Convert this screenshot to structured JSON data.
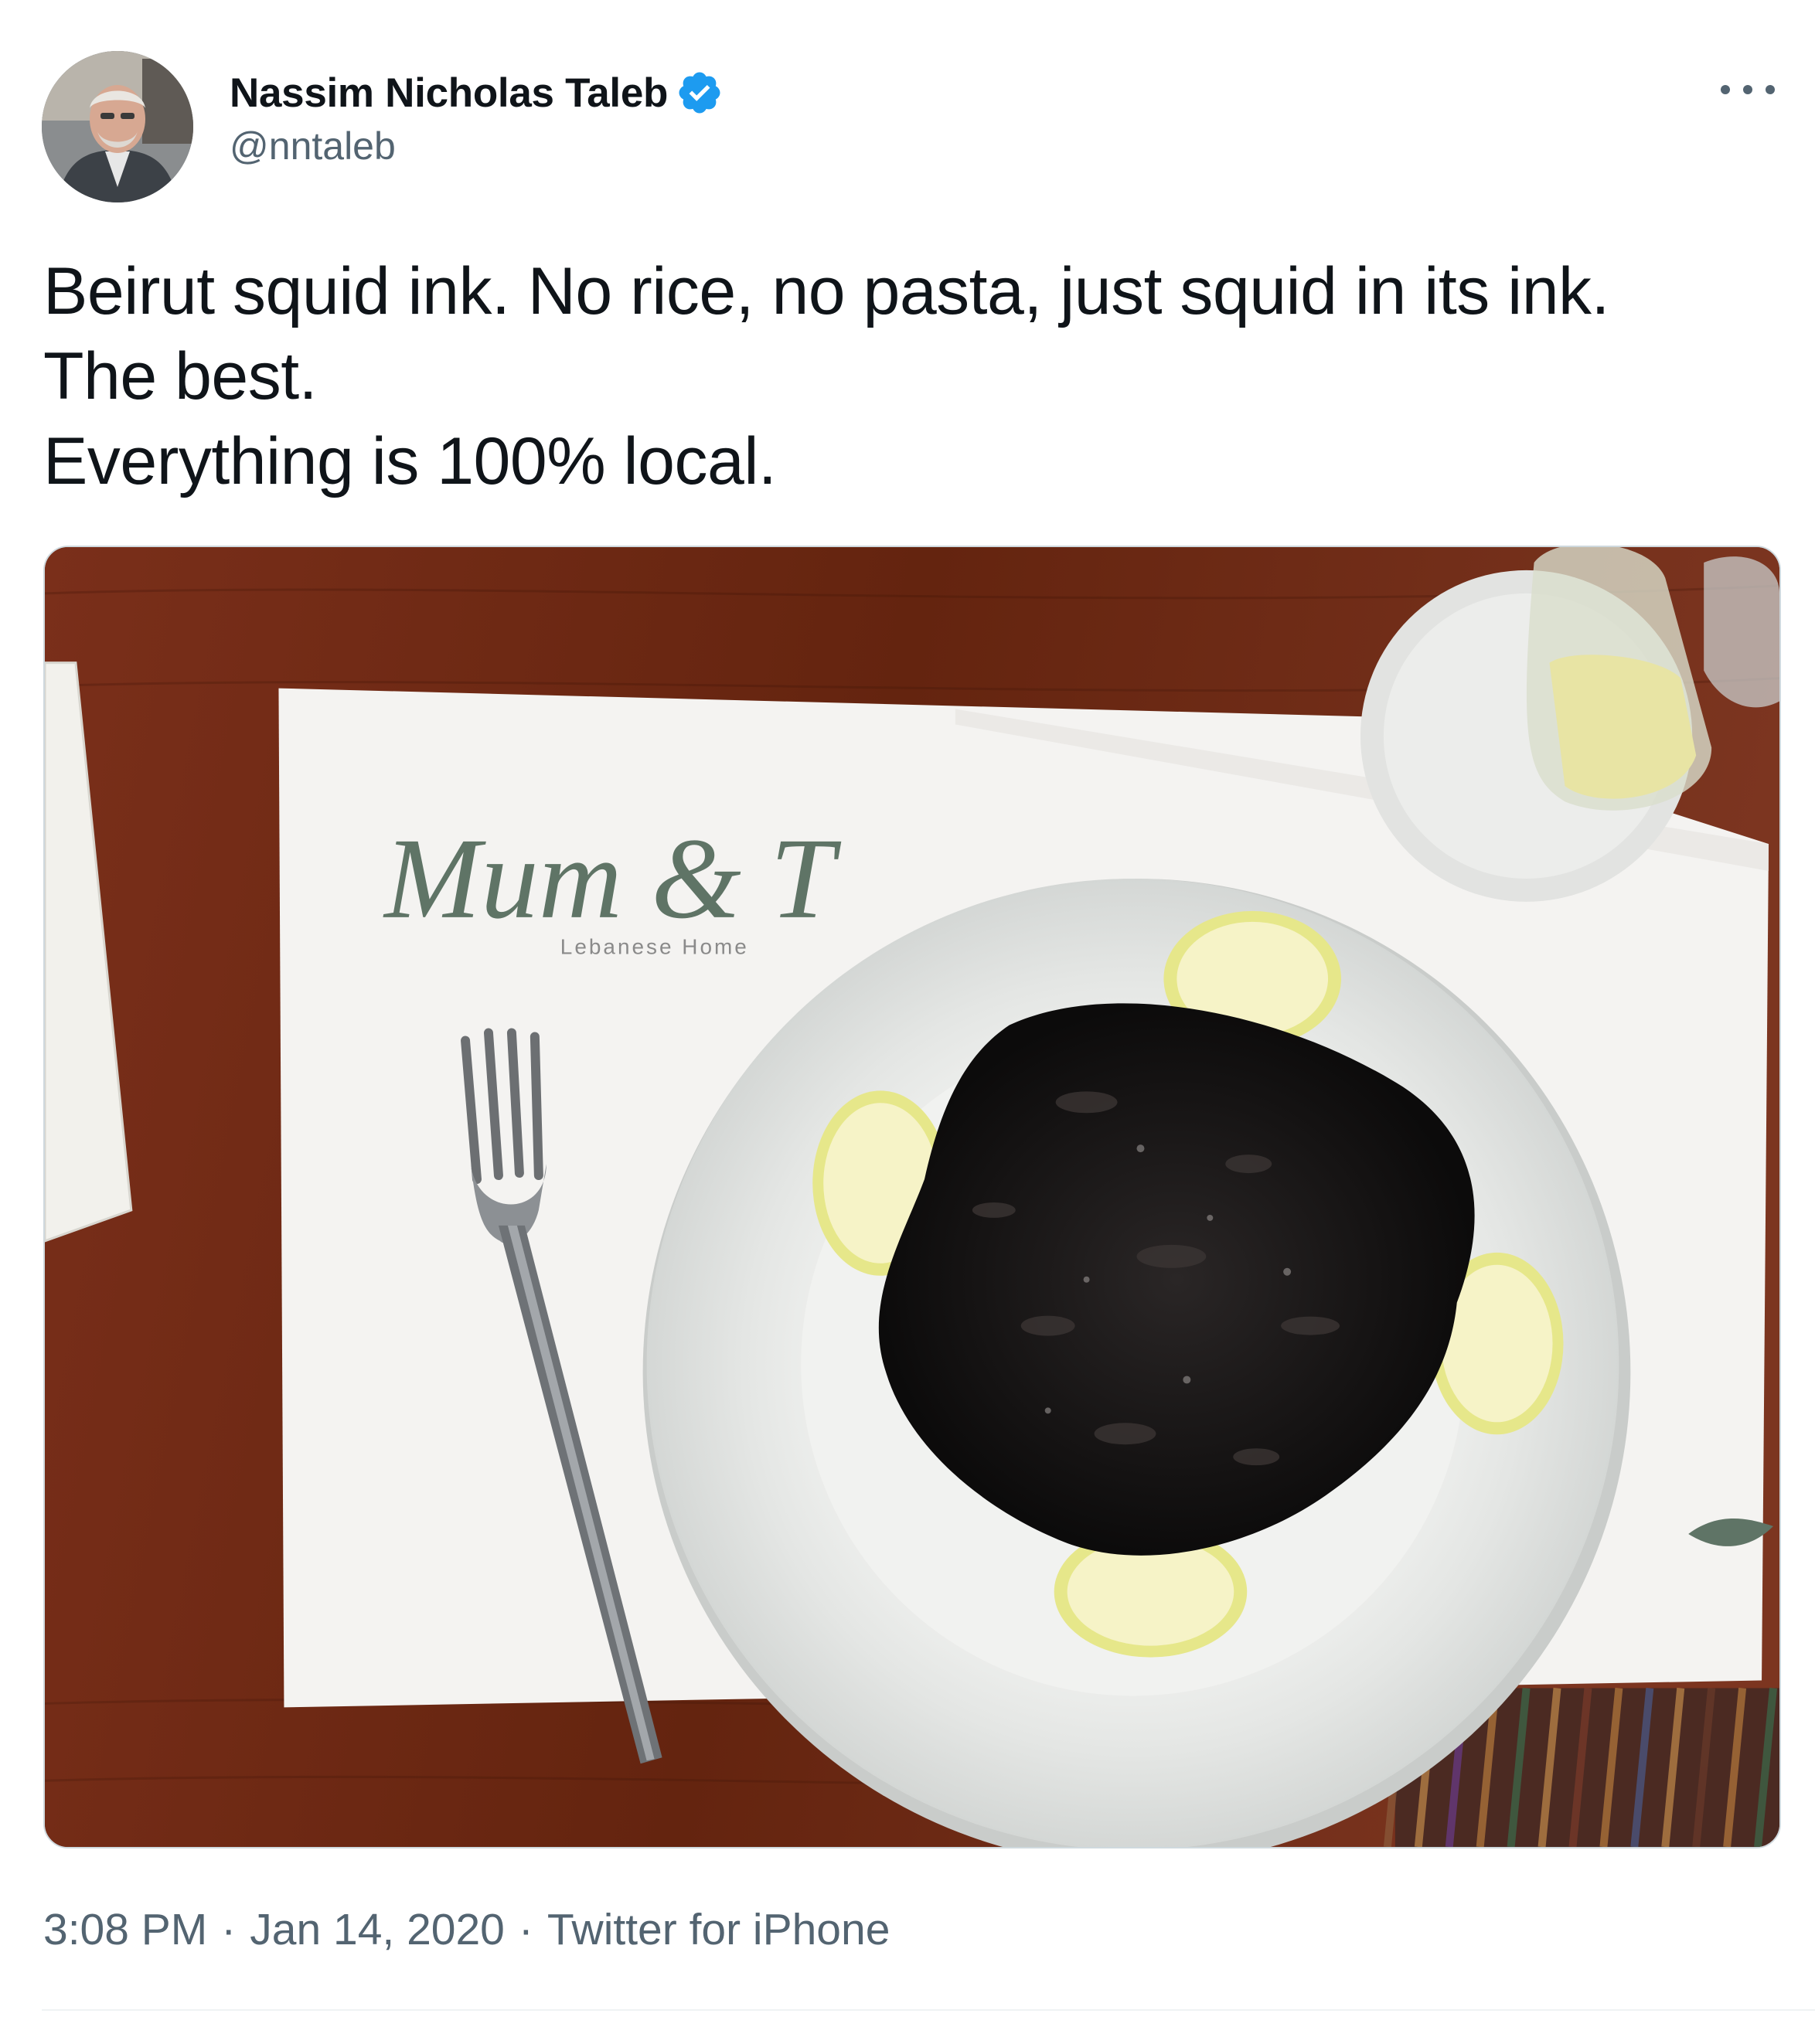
{
  "author": {
    "display_name": "Nassim Nicholas Taleb",
    "handle": "@nntaleb",
    "verified": true
  },
  "tweet": {
    "text_lines": [
      "Beirut squid ink. No rice, no pasta, just squid in its ink.",
      "The best.",
      "Everything is 100% local."
    ]
  },
  "media": {
    "placemat_logo": "Mum & T",
    "placemat_tagline": "Lebanese Home"
  },
  "meta": {
    "time": "3:08 PM",
    "separator": "·",
    "date": "Jan 14, 2020",
    "source": "Twitter for iPhone"
  },
  "colors": {
    "verified": "#1d9bf0",
    "secondary_text": "#536471",
    "primary_text": "#0f1419"
  },
  "icons": {
    "verified": "verified-badge-icon",
    "more": "more-options-icon"
  }
}
